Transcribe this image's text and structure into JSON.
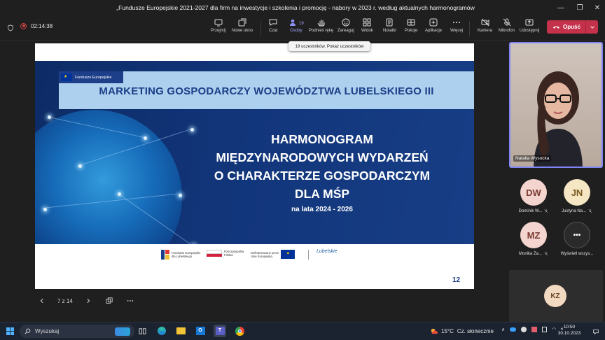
{
  "window": {
    "title": "„Fundusze Europejskie 2021-2027 dla firm na inwestycje i szkolenia i promocję - nabory w 2023 r. według aktualnych harmonogramów"
  },
  "toolbar": {
    "timer": "02:14:38",
    "items": [
      {
        "label": "Przejmij",
        "icon": "take-control-icon"
      },
      {
        "label": "Nowe okno",
        "icon": "new-window-icon"
      },
      {
        "label": "Czat",
        "icon": "chat-icon"
      },
      {
        "label": "Osoby",
        "icon": "people-icon",
        "badge": "19"
      },
      {
        "label": "Podnieś rękę",
        "icon": "raise-hand-icon"
      },
      {
        "label": "Zareaguj",
        "icon": "react-icon"
      },
      {
        "label": "Widok",
        "icon": "view-icon"
      },
      {
        "label": "Notatki",
        "icon": "notes-icon"
      },
      {
        "label": "Pokoje",
        "icon": "rooms-icon"
      },
      {
        "label": "Aplikacje",
        "icon": "apps-icon"
      },
      {
        "label": "Więcej",
        "icon": "more-icon"
      },
      {
        "label": "Kamera",
        "icon": "camera-off-icon"
      },
      {
        "label": "Mikrofon",
        "icon": "mic-off-icon"
      },
      {
        "label": "Udostępnij",
        "icon": "share-icon"
      }
    ],
    "leave_label": "Opuść",
    "accent_color": "#c4314b"
  },
  "tooltip": "19 uczestników. Pokaż uczestników",
  "slide": {
    "eu_tag": "Fundusze Europejskie",
    "header": "MARKETING GOSPODARCZY WOJEWÓDZTWA LUBELSKIEGO III",
    "main_lines": [
      "HARMONOGRAM",
      "MIĘDZYNARODOWYCH WYDARZEŃ",
      "O CHARAKTERZE GOSPODARCZYM",
      "DLA MŚP"
    ],
    "subtitle": "na lata 2024 - 2026",
    "logos": {
      "fe_line1": "Fundusze Europejskie",
      "fe_line2": "dla Lubelskiego",
      "rp_line1": "Rzeczpospolita",
      "rp_line2": "Polska",
      "eu_line1": "Dofinansowane przez",
      "eu_line2": "Unię Europejską",
      "lub": "Lubelskie"
    },
    "page_number": "12"
  },
  "slide_nav": {
    "counter": "7 z 14"
  },
  "participants": {
    "video_name": "Natalia Wysocka",
    "tiles": [
      {
        "initials": "DW",
        "name": "Dominik W...",
        "bg": "#f3d4cf",
        "fg": "#7a3b33"
      },
      {
        "initials": "JN",
        "name": "Justyna Na...",
        "bg": "#f5e6c4",
        "fg": "#7a5a1d"
      },
      {
        "initials": "MZ",
        "name": "Monika Za...",
        "bg": "#f3d4cf",
        "fg": "#7a3b33"
      },
      {
        "initials": "•••",
        "name": "Wyświetl wszys...",
        "bg": "#2a2a2a",
        "fg": "#ffffff"
      }
    ],
    "bottom_tile": "KZ"
  },
  "taskbar": {
    "search_label": "Wyszukaj",
    "weather_temp": "15°C",
    "weather_desc": "Cz. słonecznie",
    "time": "10:50",
    "date": "30.10.2023"
  }
}
